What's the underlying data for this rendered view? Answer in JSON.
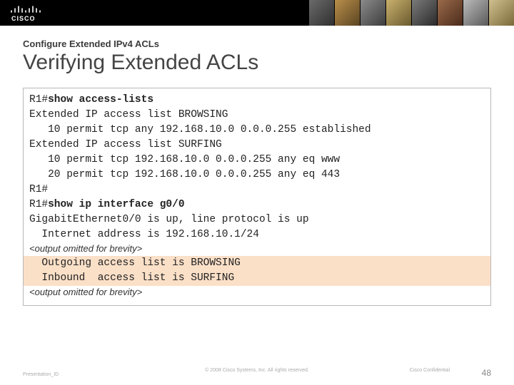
{
  "banner": {
    "logo_alt": "cisco"
  },
  "header": {
    "subtitle": "Configure Extended IPv4 ACLs",
    "title": "Verifying Extended ACLs"
  },
  "terminal": {
    "p1": "R1#",
    "cmd1": "show access-lists",
    "l2": "Extended IP access list BROWSING",
    "l3": "   10 permit tcp any 192.168.10.0 0.0.0.255 established",
    "l4": "Extended IP access list SURFING",
    "l5": "   10 permit tcp 192.168.10.0 0.0.0.255 any eq www",
    "l6": "   20 permit tcp 192.168.10.0 0.0.0.255 any eq 443",
    "l7": "R1#",
    "p2": "R1#",
    "cmd2": "show ip interface g0/0",
    "l9": "GigabitEthernet0/0 is up, line protocol is up",
    "l10": "  Internet address is 192.168.10.1/24",
    "omit1": "<output omitted for brevity>",
    "hl1": "  Outgoing access list is BROWSING",
    "hl2": "  Inbound  access list is SURFING",
    "omit2": "<output omitted for brevity>"
  },
  "footer": {
    "left": "Presentation_ID",
    "center": "© 2008 Cisco Systems, Inc. All rights reserved.",
    "confidential": "Cisco Confidential",
    "page": "48"
  }
}
